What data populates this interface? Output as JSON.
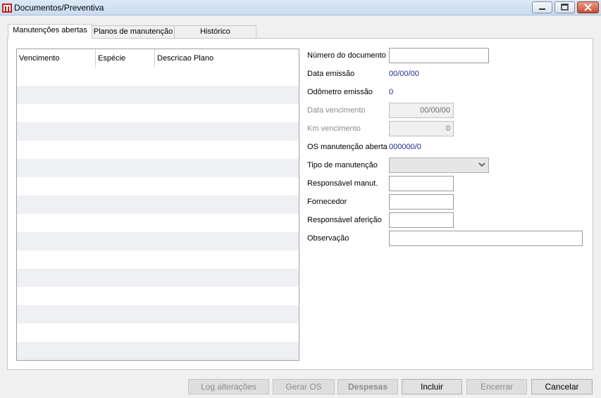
{
  "window": {
    "title": "Documentos/Preventiva"
  },
  "tabs": [
    {
      "label": "Manutenções abertas",
      "active": true
    },
    {
      "label": "Planos de manutenção",
      "active": false
    },
    {
      "label": "Histórico",
      "active": false
    }
  ],
  "grid": {
    "columns": [
      "Vencimento",
      "Espécie",
      "Descricao Plano"
    ],
    "rows": []
  },
  "form": {
    "numero_documento": {
      "label": "Número do documento",
      "value": ""
    },
    "data_emissao": {
      "label": "Data emissão",
      "value": "00/00/00"
    },
    "odometro_emissao": {
      "label": "Odômetro emissão",
      "value": "0"
    },
    "data_vencimento": {
      "label": "Data vencimento",
      "value": "00/00/00"
    },
    "km_vencimento": {
      "label": "Km vencimento",
      "value": "0"
    },
    "os_manutencao": {
      "label": "OS manutenção aberta",
      "value": "000000/0"
    },
    "tipo_manutencao": {
      "label": "Tipo de manutenção",
      "value": ""
    },
    "responsavel_manut": {
      "label": "Responsável manut.",
      "value": ""
    },
    "fornecedor": {
      "label": "Fornecedor",
      "value": ""
    },
    "responsavel_afericao": {
      "label": "Responsável aferição",
      "value": ""
    },
    "observacao": {
      "label": "Observação",
      "value": ""
    }
  },
  "buttons": {
    "log": "Log alterações",
    "gerar_os": "Gerar OS",
    "despesas": "Despesas",
    "incluir": "Incluir",
    "encerrar": "Encerrar",
    "cancelar": "Cancelar"
  },
  "colors": {
    "value_text": "#1f2a8c",
    "titlebar": "#c9dcf1"
  }
}
